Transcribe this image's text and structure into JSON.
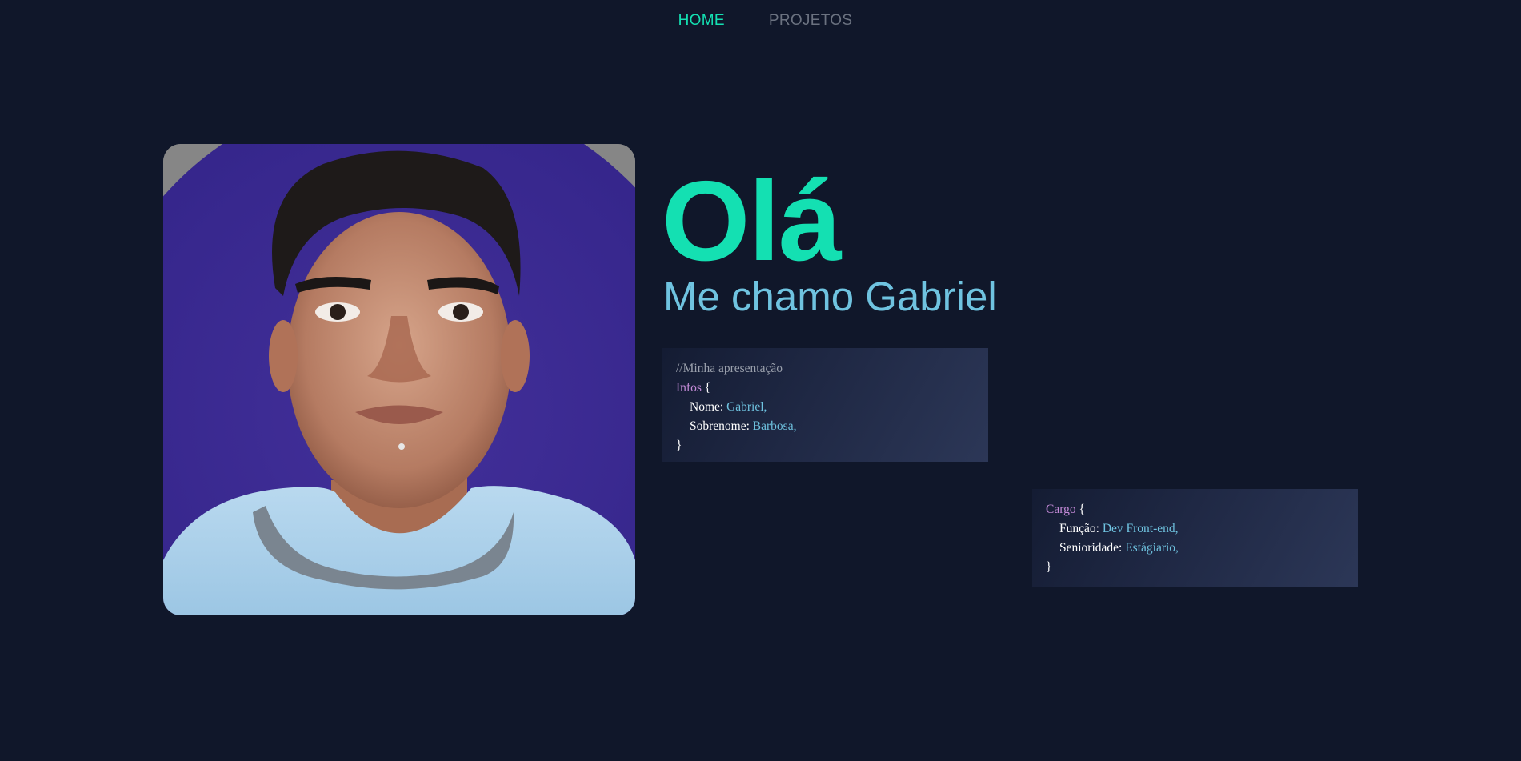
{
  "nav": {
    "items": [
      {
        "label": "HOME",
        "active": true
      },
      {
        "label": "PROJETOS",
        "active": false
      }
    ]
  },
  "hero": {
    "greeting": "Olá",
    "subtitle": "Me chamo Gabriel"
  },
  "infos_card": {
    "comment": "//Minha apresentação",
    "object_name": "Infos",
    "open_brace": "{",
    "close_brace": "}",
    "fields": [
      {
        "key": "Nome:",
        "value": "Gabriel,"
      },
      {
        "key": "Sobrenome:",
        "value": "Barbosa,"
      }
    ]
  },
  "cargo_card": {
    "object_name": "Cargo",
    "open_brace": "{",
    "close_brace": "}",
    "fields": [
      {
        "key": "Função:",
        "value": "Dev Front-end,"
      },
      {
        "key": "Senioridade:",
        "value": "Estágiario,"
      }
    ]
  },
  "colors": {
    "background": "#10172a",
    "accent": "#14e0b2",
    "subtitle": "#6fc3e0",
    "nav_inactive": "#6b7280",
    "code_keyword": "#c58bd9",
    "code_value": "#6fc3e0"
  }
}
